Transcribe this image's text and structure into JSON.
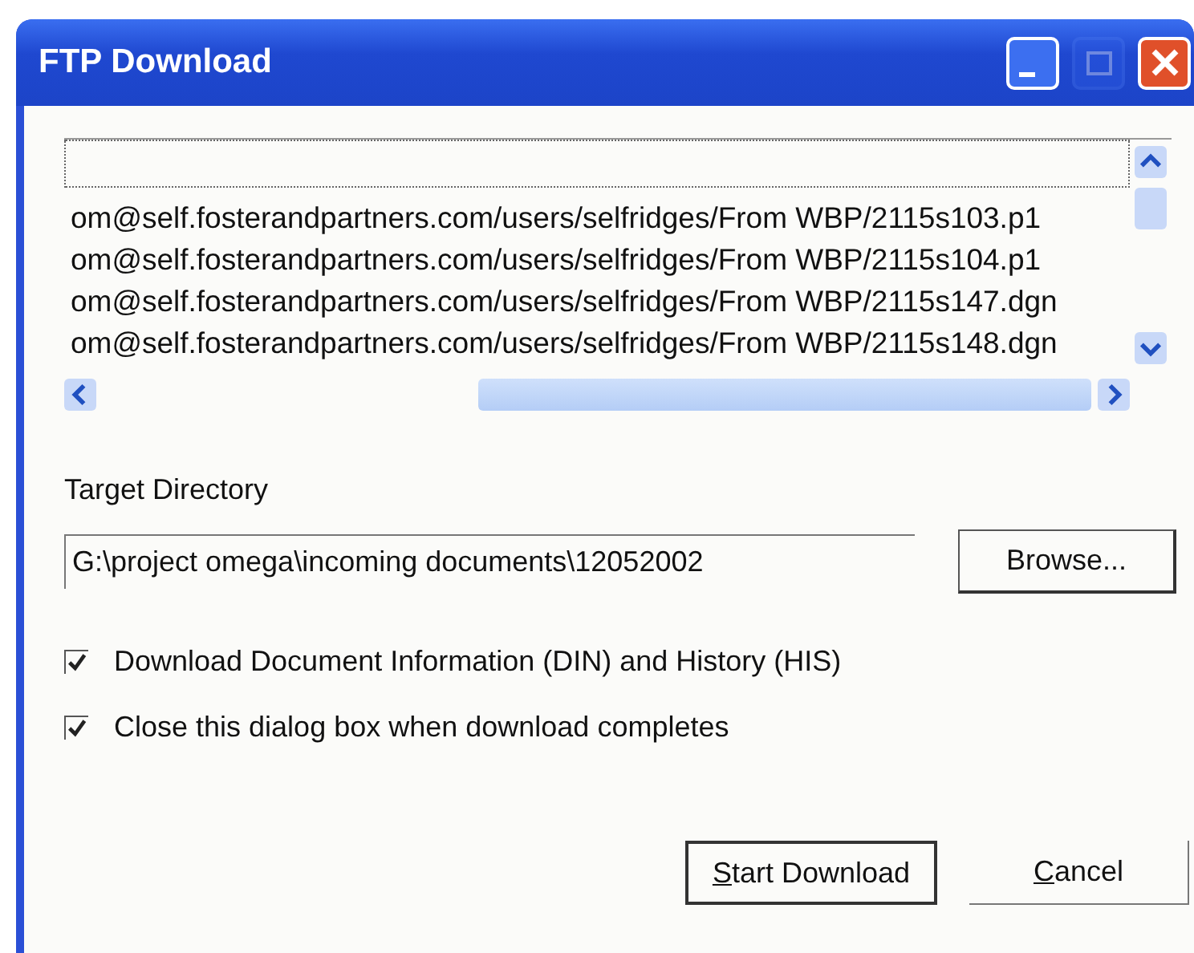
{
  "window": {
    "title": "FTP Download",
    "controls": [
      {
        "kind": "minimize",
        "disabled": false
      },
      {
        "kind": "maximize",
        "disabled": true
      },
      {
        "kind": "close",
        "disabled": false
      }
    ]
  },
  "file_list": {
    "focus_row": true,
    "rows": [
      {
        "text": "om@self.fosterandpartners.com/users/selfridges/From WBP/2115s103.p1"
      },
      {
        "text": "om@self.fosterandpartners.com/users/selfridges/From WBP/2115s104.p1"
      },
      {
        "text": "om@self.fosterandpartners.com/users/selfridges/From WBP/2115s147.dgn"
      },
      {
        "text": "om@self.fosterandpartners.com/users/selfridges/From WBP/2115s148.dgn"
      }
    ]
  },
  "target_directory": {
    "label": "Target Directory",
    "value": "G:\\project omega\\incoming documents\\12052002",
    "browse_button": "Browse..."
  },
  "options": [
    {
      "label": "Download Document Information (DIN) and History (HIS)",
      "checked": true
    },
    {
      "label": "Close this dialog box when download completes",
      "checked": true
    }
  ],
  "buttons": [
    {
      "label": "Start Download",
      "default": true,
      "underline_first": true
    },
    {
      "label": "Cancel",
      "default": false,
      "underline_first": true
    }
  ]
}
